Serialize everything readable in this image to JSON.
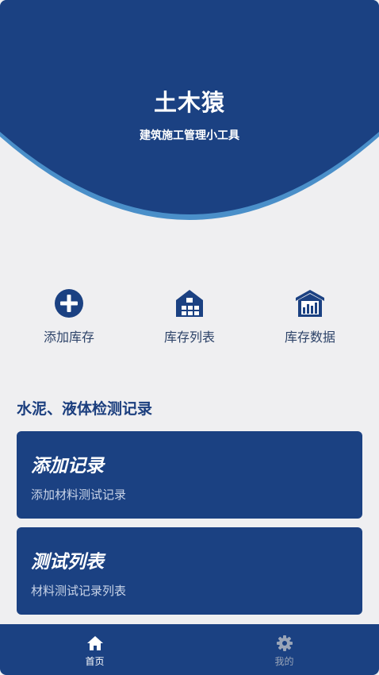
{
  "header": {
    "title": "土木猿",
    "subtitle": "建筑施工管理小工具"
  },
  "quick_actions": [
    {
      "label": "添加库存",
      "icon": "plus-circle-icon"
    },
    {
      "label": "库存列表",
      "icon": "warehouse-icon"
    },
    {
      "label": "库存数据",
      "icon": "warehouse-chart-icon"
    }
  ],
  "section": {
    "title": "水泥、液体检测记录"
  },
  "cards": [
    {
      "title": "添加记录",
      "desc": "添加材料测试记录"
    },
    {
      "title": "测试列表",
      "desc": "材料测试记录列表"
    }
  ],
  "tabbar": {
    "tabs": [
      {
        "label": "首页",
        "icon": "home-icon",
        "active": true
      },
      {
        "label": "我的",
        "icon": "gear-icon",
        "active": false
      }
    ]
  },
  "colors": {
    "primary": "#1b4182",
    "accent_edge": "#4a8fc9",
    "background": "#efeff1",
    "section_title": "#1b3e7e",
    "quick_action_label": "#2c4268",
    "inactive_tab": "#9aa5b8"
  }
}
